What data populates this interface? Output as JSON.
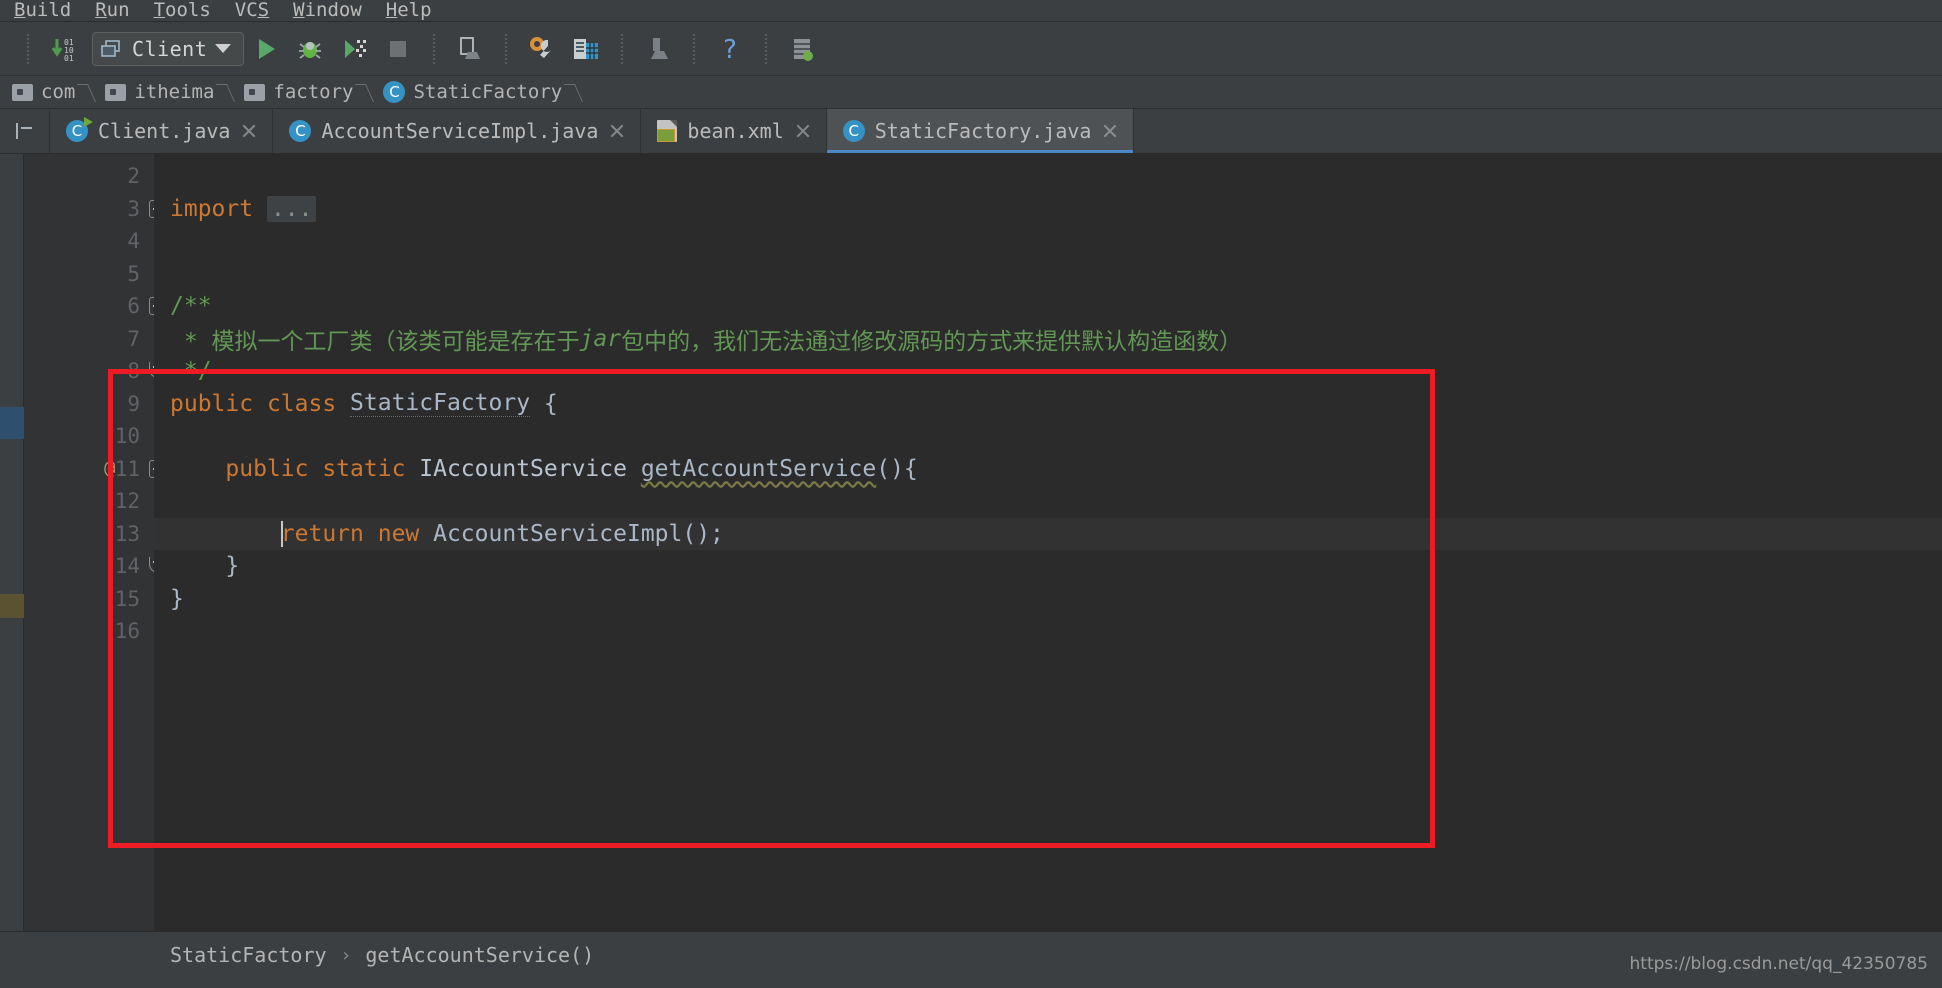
{
  "menubar": {
    "items": [
      {
        "label": "Build",
        "mnemonic": "B",
        "rest": "uild"
      },
      {
        "label": "Run",
        "mnemonic": "R",
        "rest": "un"
      },
      {
        "label": "Tools",
        "mnemonic": "T",
        "rest": "ools"
      },
      {
        "label": "VCS",
        "mnemonic": "S",
        "pre": "VC"
      },
      {
        "label": "Window",
        "mnemonic": "W",
        "rest": "indow"
      },
      {
        "label": "Help",
        "mnemonic": "H",
        "rest": "elp"
      }
    ]
  },
  "toolbar": {
    "run_config": "Client",
    "icons": [
      "update-project-icon",
      "run-icon",
      "debug-icon",
      "run-with-coverage-icon",
      "stop-icon",
      "project-structure-icon",
      "settings-icon",
      "sdk-manager-icon",
      "search-everywhere-icon",
      "help-icon",
      "database-icon"
    ]
  },
  "navbar": {
    "crumbs": [
      {
        "label": "com",
        "icon": "folder-icon"
      },
      {
        "label": "itheima",
        "icon": "folder-icon"
      },
      {
        "label": "factory",
        "icon": "folder-icon"
      },
      {
        "label": "StaticFactory",
        "icon": "class-icon"
      }
    ]
  },
  "tabs": [
    {
      "label": "Client.java",
      "icon": "runnable-class-icon",
      "active": false
    },
    {
      "label": "AccountServiceImpl.java",
      "icon": "class-icon",
      "active": false
    },
    {
      "label": "bean.xml",
      "icon": "xml-file-icon",
      "active": false
    },
    {
      "label": "StaticFactory.java",
      "icon": "class-icon",
      "active": true
    }
  ],
  "editor": {
    "first_line_number": 2,
    "lines": [
      {
        "num": 2,
        "tokens": []
      },
      {
        "num": 3,
        "fold": "plus",
        "tokens": [
          {
            "t": "import ",
            "c": "kw"
          },
          {
            "t": "...",
            "c": "folded"
          }
        ]
      },
      {
        "num": 4,
        "tokens": []
      },
      {
        "num": 5,
        "tokens": []
      },
      {
        "num": 6,
        "fold": "minus",
        "tokens": [
          {
            "t": "/**",
            "c": "cmt"
          }
        ]
      },
      {
        "num": 7,
        "tokens": [
          {
            "t": " * 模拟一个工厂类（该类可能是存在于",
            "c": "cmt"
          },
          {
            "t": "jar",
            "c": "cmt-i"
          },
          {
            "t": "包中的，我们无法通过修改源码的方式来提供默认构造函数）",
            "c": "cmt"
          }
        ]
      },
      {
        "num": 8,
        "foldend": true,
        "tokens": [
          {
            "t": " */",
            "c": "cmt"
          }
        ]
      },
      {
        "num": 9,
        "tokens": [
          {
            "t": "public ",
            "c": "kw"
          },
          {
            "t": "class ",
            "c": "kw"
          },
          {
            "t": "StaticFactory",
            "c": "cls"
          },
          {
            "t": " {",
            "c": "plain"
          }
        ]
      },
      {
        "num": 10,
        "tokens": []
      },
      {
        "num": 11,
        "annot": "@",
        "fold": "minus",
        "tokens": [
          {
            "t": "    ",
            "c": "plain"
          },
          {
            "t": "public ",
            "c": "kw"
          },
          {
            "t": "static ",
            "c": "kw"
          },
          {
            "t": "IAccountService ",
            "c": "iface"
          },
          {
            "t": "getAccountService",
            "c": "mth-warn"
          },
          {
            "t": "(){",
            "c": "plain"
          }
        ]
      },
      {
        "num": 12,
        "tokens": []
      },
      {
        "num": 13,
        "caret": true,
        "caretline": true,
        "tokens": [
          {
            "t": "        ",
            "c": "plain"
          },
          {
            "t": "return ",
            "c": "kw"
          },
          {
            "t": "new ",
            "c": "kw"
          },
          {
            "t": "AccountServiceImpl();",
            "c": "plain"
          }
        ]
      },
      {
        "num": 14,
        "foldend": true,
        "tokens": [
          {
            "t": "    }",
            "c": "plain"
          }
        ]
      },
      {
        "num": 15,
        "tokens": [
          {
            "t": "}",
            "c": "plain"
          }
        ]
      },
      {
        "num": 16,
        "tokens": []
      }
    ]
  },
  "statusbar": {
    "crumbs": [
      "StaticFactory",
      "getAccountService()"
    ],
    "separator": "›",
    "watermark": "https://blog.csdn.net/qq_42350785"
  },
  "colors": {
    "accent": "#4a88c7",
    "keyword": "#cc7832",
    "comment": "#629755",
    "annotation_box": "#ed1c24",
    "editor_bg": "#2b2b2b",
    "chrome_bg": "#3c3f41"
  }
}
